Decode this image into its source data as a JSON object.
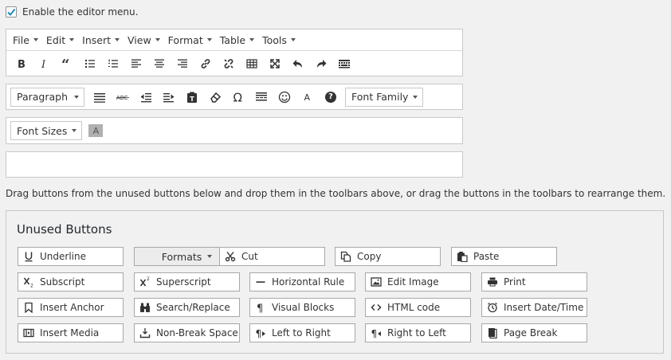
{
  "enable": {
    "label": "Enable the editor menu.",
    "checked": true
  },
  "menubar": {
    "items": [
      "File",
      "Edit",
      "Insert",
      "View",
      "Format",
      "Table",
      "Tools"
    ]
  },
  "toolbar2": {
    "paragraph": "Paragraph",
    "font_family": "Font Family"
  },
  "toolbar3": {
    "font_sizes": "Font Sizes",
    "a_label": "A"
  },
  "hint": "Drag buttons from the unused buttons below and drop them in the toolbars above, or drag the buttons in the toolbars to rearrange them.",
  "unused": {
    "title": "Unused Buttons",
    "buttons": [
      [
        "Underline",
        "Formats",
        "Cut",
        "Copy",
        "Paste"
      ],
      [
        "Subscript",
        "Superscript",
        "Horizontal Rule",
        "Edit Image",
        "Print"
      ],
      [
        "Insert Anchor",
        "Search/Replace",
        "Visual Blocks",
        "HTML code",
        "Insert Date/Time"
      ],
      [
        "Insert Media",
        "Non-Break Space",
        "Left to Right",
        "Right to Left",
        "Page Break"
      ]
    ]
  },
  "colors": {
    "accent": "#1e8cbe",
    "border": "#c8c8c8",
    "background": "#f1f1f1"
  }
}
